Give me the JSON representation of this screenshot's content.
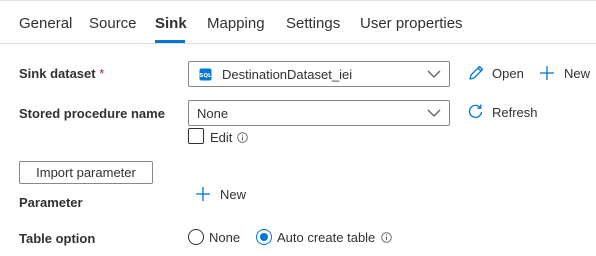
{
  "tabs": [
    {
      "label": "General",
      "active": false
    },
    {
      "label": "Source",
      "active": false
    },
    {
      "label": "Sink",
      "active": true
    },
    {
      "label": "Mapping",
      "active": false
    },
    {
      "label": "Settings",
      "active": false
    },
    {
      "label": "User properties",
      "active": false
    }
  ],
  "sink_dataset": {
    "label": "Sink dataset",
    "required_marker": "*",
    "value": "DestinationDataset_iei",
    "icon": "sql-database-icon",
    "open_label": "Open",
    "new_label": "New"
  },
  "stored_procedure": {
    "label": "Stored procedure name",
    "value": "None",
    "refresh_label": "Refresh",
    "edit_label": "Edit",
    "edit_checked": false
  },
  "parameters": {
    "import_button_label": "Import parameter",
    "label": "Parameter",
    "new_label": "New"
  },
  "table_option": {
    "label": "Table option",
    "options": [
      {
        "label": "None",
        "selected": false
      },
      {
        "label": "Auto create table",
        "selected": true
      }
    ]
  },
  "colors": {
    "accent": "#0078d4",
    "text": "#323130",
    "border": "#8a8886",
    "required": "#a4262c"
  }
}
